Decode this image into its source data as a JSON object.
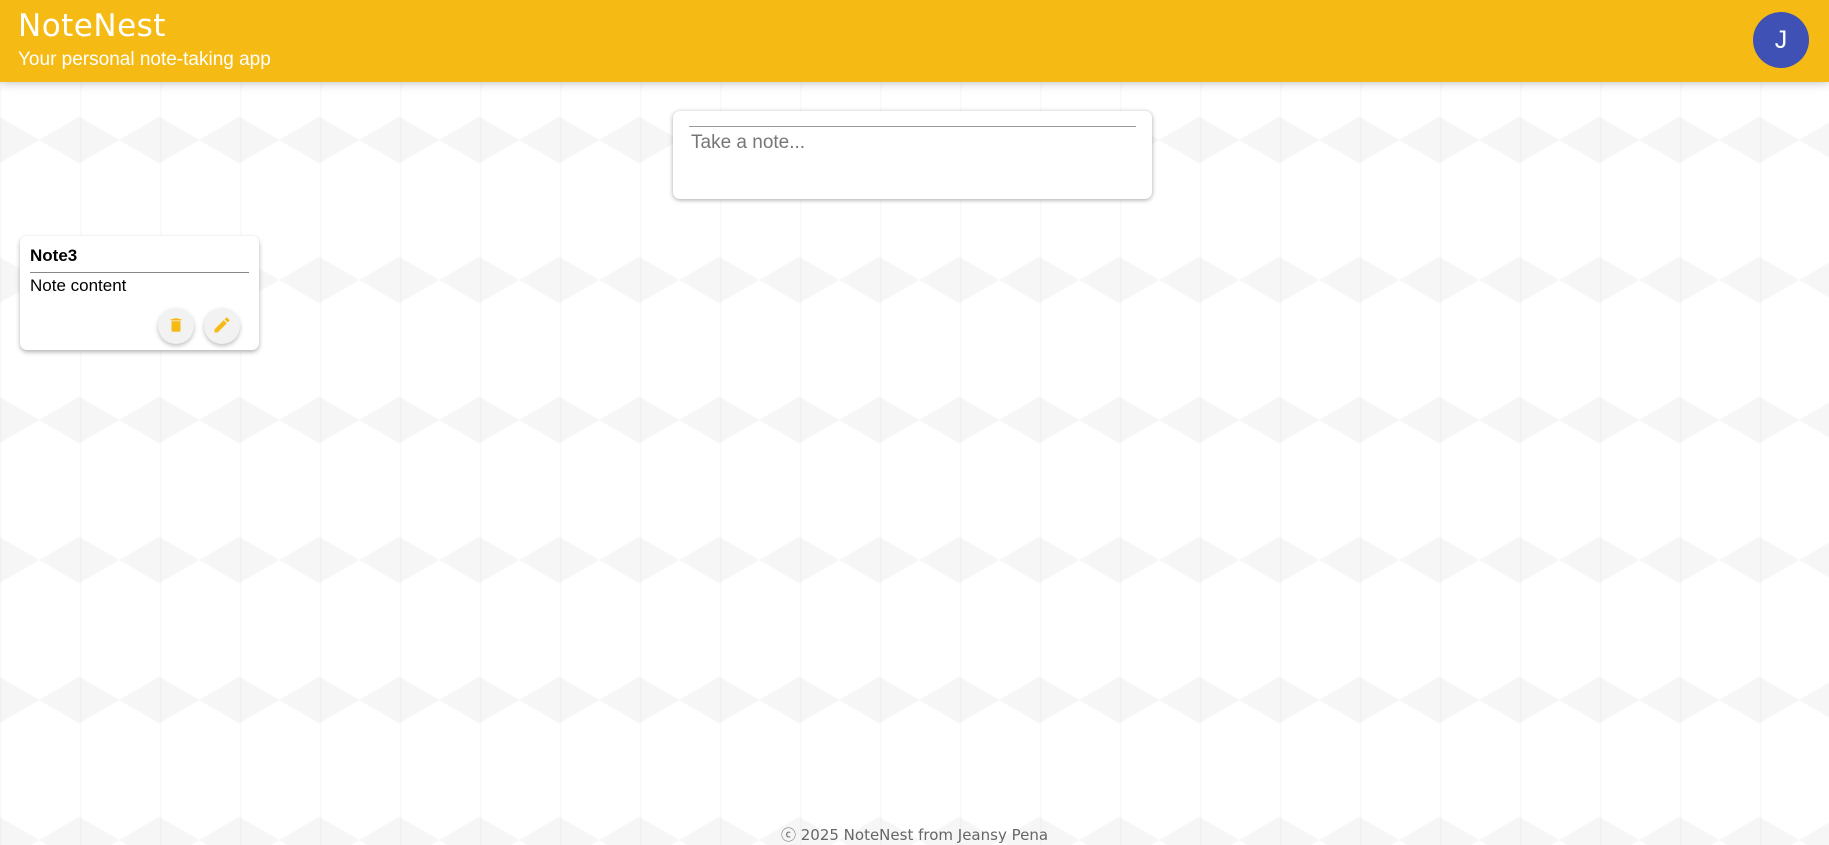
{
  "header": {
    "title": "NoteNest",
    "subtitle": "Your personal note-taking app",
    "avatar_initial": "J",
    "accent_color": "#f5ba13",
    "avatar_color": "#3f51b5"
  },
  "create_note": {
    "placeholder": "Take a note..."
  },
  "notes": [
    {
      "title": "Note3",
      "content": "Note content",
      "actions": [
        {
          "icon": "trash-icon"
        },
        {
          "icon": "pencil-icon"
        }
      ]
    }
  ],
  "footer": {
    "text": "ⓒ 2025 NoteNest from Jeansy Pena"
  }
}
